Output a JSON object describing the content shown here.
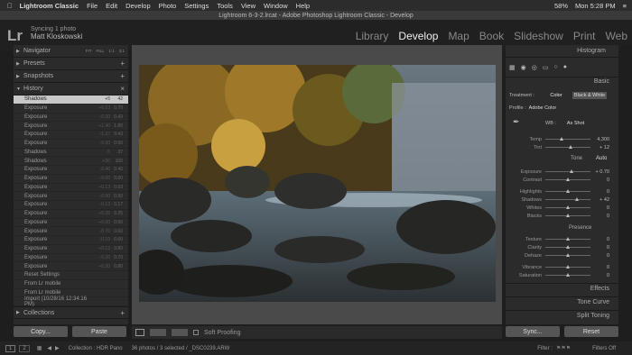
{
  "macbar": {
    "app": "Lightroom Classic",
    "menus": [
      "File",
      "Edit",
      "Develop",
      "Photo",
      "Settings",
      "Tools",
      "View",
      "Window",
      "Help"
    ],
    "battery": "58%",
    "time": "Mon 5:28 PM"
  },
  "window_title": "Lightroom 6-3-2.lrcat - Adobe Photoshop Lightroom Classic - Develop",
  "identity": {
    "status": "Syncing 1 photo",
    "name": "Matt Kloskowski"
  },
  "logo": "Lr",
  "modules": [
    "Library",
    "Develop",
    "Map",
    "Book",
    "Slideshow",
    "Print",
    "Web"
  ],
  "left_panels": {
    "navigator": "Navigator",
    "nav_zoom": [
      "FIT",
      "FILL",
      "1:1",
      "3:1"
    ],
    "presets": "Presets",
    "snapshots": "Snapshots",
    "history": "History",
    "collections": "Collections"
  },
  "history": [
    {
      "label": "Shadows",
      "a": "+5",
      "b": "42",
      "selected": true
    },
    {
      "label": "Exposure",
      "a": "+0.23",
      "b": "0.70"
    },
    {
      "label": "Exposure",
      "a": "-0.30",
      "b": "0.43"
    },
    {
      "label": "Exposure",
      "a": "+1.40",
      "b": "1.80"
    },
    {
      "label": "Exposure",
      "a": "-1.37",
      "b": "0.43"
    },
    {
      "label": "Exposure",
      "a": "-0.30",
      "b": "0.60"
    },
    {
      "label": "Shadows",
      "a": "-5",
      "b": "37"
    },
    {
      "label": "Shadows",
      "a": "+30",
      "b": "100"
    },
    {
      "label": "Exposure",
      "a": "-0.40",
      "b": "0.40"
    },
    {
      "label": "Exposure",
      "a": "-0.60",
      "b": "0.00"
    },
    {
      "label": "Exposure",
      "a": "+0.13",
      "b": "0.63"
    },
    {
      "label": "Exposure",
      "a": "-0.90",
      "b": "0.50"
    },
    {
      "label": "Exposure",
      "a": "-0.13",
      "b": "0.17"
    },
    {
      "label": "Exposure",
      "a": "+0.35",
      "b": "0.25"
    },
    {
      "label": "Exposure",
      "a": "+0.00",
      "b": "0.60"
    },
    {
      "label": "Exposure",
      "a": "-0.70",
      "b": "0.60"
    },
    {
      "label": "Exposure",
      "a": "-0.10",
      "b": "0.60"
    },
    {
      "label": "Exposure",
      "a": "+0.13",
      "b": "0.80"
    },
    {
      "label": "Exposure",
      "a": "-0.20",
      "b": "0.70"
    },
    {
      "label": "Exposure",
      "a": "+0.30",
      "b": "0.80"
    },
    {
      "label": "Reset Settings",
      "a": "",
      "b": ""
    },
    {
      "label": "From Lr mobile",
      "a": "",
      "b": ""
    },
    {
      "label": "From Lr mobile",
      "a": "",
      "b": ""
    },
    {
      "label": "Import (10/28/16 12:34:16 PM)",
      "a": "",
      "b": ""
    }
  ],
  "buttons": {
    "copy": "Copy...",
    "paste": "Paste",
    "sync": "Sync...",
    "reset": "Reset"
  },
  "toolbar": {
    "soft_proofing": "Soft Proofing"
  },
  "right": {
    "histogram": "Histogram",
    "basic": "Basic",
    "treatment_label": "Treatment :",
    "color": "Color",
    "bw": "Black & White",
    "profile_label": "Profile :",
    "profile": "Adobe Color",
    "wb_label": "WB :",
    "wb": "As Shot",
    "tone": "Tone",
    "auto": "Auto",
    "presence": "Presence",
    "sliders": [
      {
        "label": "Temp",
        "value": "4,300",
        "pos": 0.35
      },
      {
        "label": "Tint",
        "value": "+ 12",
        "pos": 0.55
      },
      {
        "label": "Exposure",
        "value": "+ 0.70",
        "pos": 0.58
      },
      {
        "label": "Contrast",
        "value": "0",
        "pos": 0.5
      },
      {
        "label": "Highlights",
        "value": "0",
        "pos": 0.5
      },
      {
        "label": "Shadows",
        "value": "+ 42",
        "pos": 0.7
      },
      {
        "label": "Whites",
        "value": "0",
        "pos": 0.5
      },
      {
        "label": "Blacks",
        "value": "0",
        "pos": 0.5
      },
      {
        "label": "Texture",
        "value": "0",
        "pos": 0.5
      },
      {
        "label": "Clarity",
        "value": "0",
        "pos": 0.5
      },
      {
        "label": "Dehaze",
        "value": "0",
        "pos": 0.5
      },
      {
        "label": "Vibrance",
        "value": "0",
        "pos": 0.5
      },
      {
        "label": "Saturation",
        "value": "0",
        "pos": 0.5
      }
    ],
    "effects": "Effects",
    "tone_curve": "Tone Curve",
    "split_toning": "Split Toning"
  },
  "filmstrip": {
    "pages": [
      "1",
      "2"
    ],
    "collection": "Collection : HDR Pano",
    "count": "36 photos / 3 selected / _DSC0239.ARW",
    "filter": "Filter :",
    "filters_off": "Filters Off"
  }
}
